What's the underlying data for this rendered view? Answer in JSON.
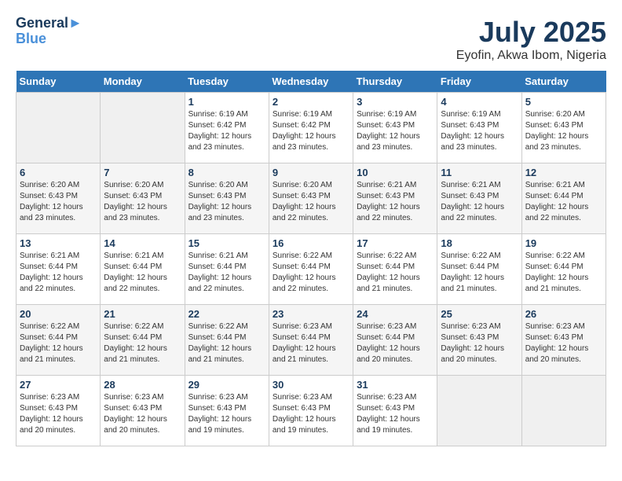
{
  "header": {
    "logo_line1": "General",
    "logo_line2": "Blue",
    "month": "July 2025",
    "location": "Eyofin, Akwa Ibom, Nigeria"
  },
  "weekdays": [
    "Sunday",
    "Monday",
    "Tuesday",
    "Wednesday",
    "Thursday",
    "Friday",
    "Saturday"
  ],
  "weeks": [
    [
      {
        "day": "",
        "info": ""
      },
      {
        "day": "",
        "info": ""
      },
      {
        "day": "1",
        "info": "Sunrise: 6:19 AM\nSunset: 6:42 PM\nDaylight: 12 hours and 23 minutes."
      },
      {
        "day": "2",
        "info": "Sunrise: 6:19 AM\nSunset: 6:42 PM\nDaylight: 12 hours and 23 minutes."
      },
      {
        "day": "3",
        "info": "Sunrise: 6:19 AM\nSunset: 6:43 PM\nDaylight: 12 hours and 23 minutes."
      },
      {
        "day": "4",
        "info": "Sunrise: 6:19 AM\nSunset: 6:43 PM\nDaylight: 12 hours and 23 minutes."
      },
      {
        "day": "5",
        "info": "Sunrise: 6:20 AM\nSunset: 6:43 PM\nDaylight: 12 hours and 23 minutes."
      }
    ],
    [
      {
        "day": "6",
        "info": "Sunrise: 6:20 AM\nSunset: 6:43 PM\nDaylight: 12 hours and 23 minutes."
      },
      {
        "day": "7",
        "info": "Sunrise: 6:20 AM\nSunset: 6:43 PM\nDaylight: 12 hours and 23 minutes."
      },
      {
        "day": "8",
        "info": "Sunrise: 6:20 AM\nSunset: 6:43 PM\nDaylight: 12 hours and 23 minutes."
      },
      {
        "day": "9",
        "info": "Sunrise: 6:20 AM\nSunset: 6:43 PM\nDaylight: 12 hours and 22 minutes."
      },
      {
        "day": "10",
        "info": "Sunrise: 6:21 AM\nSunset: 6:43 PM\nDaylight: 12 hours and 22 minutes."
      },
      {
        "day": "11",
        "info": "Sunrise: 6:21 AM\nSunset: 6:43 PM\nDaylight: 12 hours and 22 minutes."
      },
      {
        "day": "12",
        "info": "Sunrise: 6:21 AM\nSunset: 6:44 PM\nDaylight: 12 hours and 22 minutes."
      }
    ],
    [
      {
        "day": "13",
        "info": "Sunrise: 6:21 AM\nSunset: 6:44 PM\nDaylight: 12 hours and 22 minutes."
      },
      {
        "day": "14",
        "info": "Sunrise: 6:21 AM\nSunset: 6:44 PM\nDaylight: 12 hours and 22 minutes."
      },
      {
        "day": "15",
        "info": "Sunrise: 6:21 AM\nSunset: 6:44 PM\nDaylight: 12 hours and 22 minutes."
      },
      {
        "day": "16",
        "info": "Sunrise: 6:22 AM\nSunset: 6:44 PM\nDaylight: 12 hours and 22 minutes."
      },
      {
        "day": "17",
        "info": "Sunrise: 6:22 AM\nSunset: 6:44 PM\nDaylight: 12 hours and 21 minutes."
      },
      {
        "day": "18",
        "info": "Sunrise: 6:22 AM\nSunset: 6:44 PM\nDaylight: 12 hours and 21 minutes."
      },
      {
        "day": "19",
        "info": "Sunrise: 6:22 AM\nSunset: 6:44 PM\nDaylight: 12 hours and 21 minutes."
      }
    ],
    [
      {
        "day": "20",
        "info": "Sunrise: 6:22 AM\nSunset: 6:44 PM\nDaylight: 12 hours and 21 minutes."
      },
      {
        "day": "21",
        "info": "Sunrise: 6:22 AM\nSunset: 6:44 PM\nDaylight: 12 hours and 21 minutes."
      },
      {
        "day": "22",
        "info": "Sunrise: 6:22 AM\nSunset: 6:44 PM\nDaylight: 12 hours and 21 minutes."
      },
      {
        "day": "23",
        "info": "Sunrise: 6:23 AM\nSunset: 6:44 PM\nDaylight: 12 hours and 21 minutes."
      },
      {
        "day": "24",
        "info": "Sunrise: 6:23 AM\nSunset: 6:44 PM\nDaylight: 12 hours and 20 minutes."
      },
      {
        "day": "25",
        "info": "Sunrise: 6:23 AM\nSunset: 6:43 PM\nDaylight: 12 hours and 20 minutes."
      },
      {
        "day": "26",
        "info": "Sunrise: 6:23 AM\nSunset: 6:43 PM\nDaylight: 12 hours and 20 minutes."
      }
    ],
    [
      {
        "day": "27",
        "info": "Sunrise: 6:23 AM\nSunset: 6:43 PM\nDaylight: 12 hours and 20 minutes."
      },
      {
        "day": "28",
        "info": "Sunrise: 6:23 AM\nSunset: 6:43 PM\nDaylight: 12 hours and 20 minutes."
      },
      {
        "day": "29",
        "info": "Sunrise: 6:23 AM\nSunset: 6:43 PM\nDaylight: 12 hours and 19 minutes."
      },
      {
        "day": "30",
        "info": "Sunrise: 6:23 AM\nSunset: 6:43 PM\nDaylight: 12 hours and 19 minutes."
      },
      {
        "day": "31",
        "info": "Sunrise: 6:23 AM\nSunset: 6:43 PM\nDaylight: 12 hours and 19 minutes."
      },
      {
        "day": "",
        "info": ""
      },
      {
        "day": "",
        "info": ""
      }
    ]
  ]
}
